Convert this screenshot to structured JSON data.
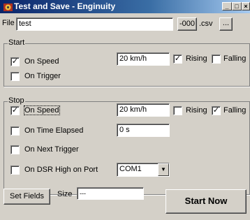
{
  "window": {
    "title": "Test and Save - Enginuity",
    "minimize": "_",
    "maximize": "□",
    "close": "×"
  },
  "file": {
    "label": "File",
    "value": "test",
    "suffix_button": "-000",
    "extension": ".csv",
    "browse_button": "..."
  },
  "start": {
    "group_label": "Start",
    "on_speed": {
      "label": "On Speed",
      "checked": true,
      "value": "20 km/h"
    },
    "rising": {
      "label": "Rising",
      "checked": true
    },
    "falling": {
      "label": "Falling",
      "checked": false
    },
    "on_trigger": {
      "label": "On Trigger",
      "checked": false
    }
  },
  "stop": {
    "group_label": "Stop",
    "on_speed": {
      "label": "On Speed",
      "checked": true,
      "value": "20 km/h"
    },
    "rising": {
      "label": "Rising",
      "checked": false
    },
    "falling": {
      "label": "Falling",
      "checked": true
    },
    "on_time_elapsed": {
      "label": "On Time Elapsed",
      "checked": false,
      "value": "0 s"
    },
    "on_next_trigger": {
      "label": "On Next Trigger",
      "checked": false
    },
    "on_dsr": {
      "label": "On DSR High on Port",
      "checked": false,
      "port": "COM1"
    }
  },
  "footer": {
    "set_fields": "Set Fields",
    "size_label": "Size",
    "size_value": "---",
    "start_now": "Start Now"
  },
  "checkmark": "✓"
}
